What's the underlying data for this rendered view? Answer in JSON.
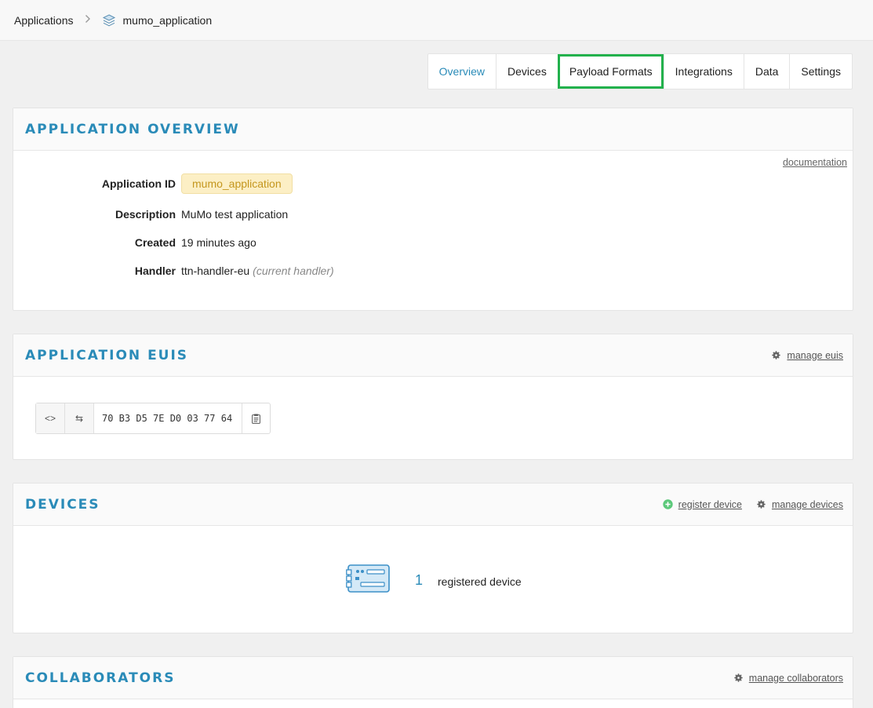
{
  "breadcrumb": {
    "root": "Applications",
    "separator": ">",
    "current": "mumo_application",
    "icon": "stack-layers-icon"
  },
  "tabs": [
    {
      "label": "Overview",
      "active": true
    },
    {
      "label": "Devices"
    },
    {
      "label": "Payload Formats",
      "highlighted": true
    },
    {
      "label": "Integrations"
    },
    {
      "label": "Data"
    },
    {
      "label": "Settings"
    }
  ],
  "overview": {
    "title": "APPLICATION OVERVIEW",
    "documentation_link": "documentation",
    "fields": {
      "app_id_label": "Application ID",
      "app_id_value": "mumo_application",
      "description_label": "Description",
      "description_value": "MuMo test application",
      "created_label": "Created",
      "created_value": "19 minutes ago",
      "handler_label": "Handler",
      "handler_value": "ttn-handler-eu",
      "handler_note": "(current handler)"
    }
  },
  "euis": {
    "title": "APPLICATION EUIS",
    "manage_link": "manage euis",
    "eui_value": "70 B3 D5 7E D0 03 77 64",
    "code_toggle": "<>",
    "swap_toggle": "⇆"
  },
  "devices": {
    "title": "DEVICES",
    "register_link": "register device",
    "manage_link": "manage devices",
    "count": "1",
    "count_label": "registered device"
  },
  "collaborators": {
    "title": "COLLABORATORS",
    "manage_link": "manage collaborators"
  },
  "colors": {
    "accent": "#2a8bb8",
    "highlight": "#22b14c",
    "pill_bg": "#fcefc5",
    "pill_text": "#c4961d"
  }
}
